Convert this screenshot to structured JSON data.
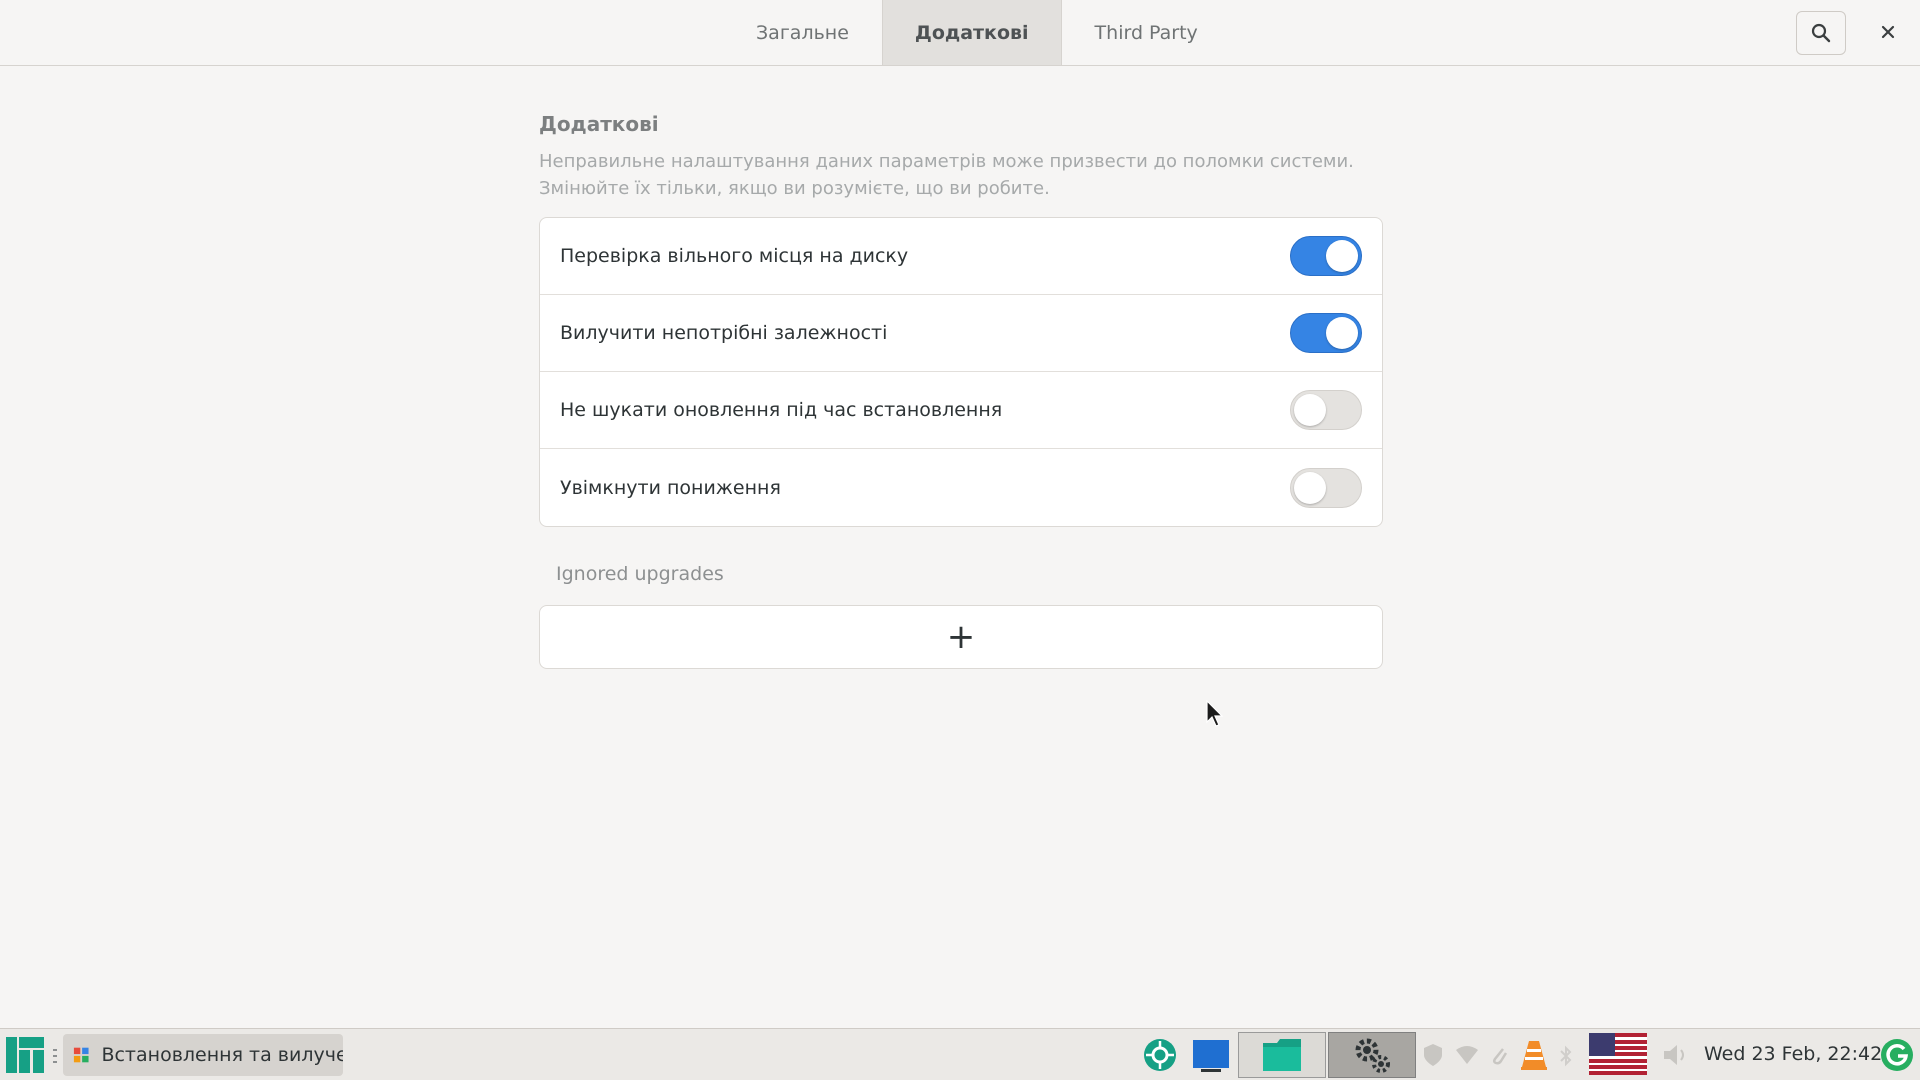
{
  "header": {
    "tabs": [
      {
        "label": "Загальне",
        "active": false
      },
      {
        "label": "Додаткові",
        "active": true
      },
      {
        "label": "Third Party",
        "active": false
      }
    ],
    "search_icon": "search-icon",
    "close_icon": "close-icon"
  },
  "section": {
    "title": "Додаткові",
    "description_line1": "Неправильне налаштування даних параметрів може призвести до поломки системи.",
    "description_line2": "Змінюйте їх тільки, якщо ви розумієте, що ви робите."
  },
  "settings": [
    {
      "label": "Перевірка вільного місця на диску",
      "enabled": true
    },
    {
      "label": "Вилучити непотрібні залежності",
      "enabled": true
    },
    {
      "label": "Не шукати оновлення під час встановлення",
      "enabled": false
    },
    {
      "label": "Увімкнути пониження",
      "enabled": false
    }
  ],
  "ignored_upgrades": {
    "label": "Ignored upgrades",
    "add_symbol": "+"
  },
  "taskbar": {
    "task_label": "Встановлення та вилуче...",
    "clock": "Wed 23 Feb, 22:42"
  },
  "colors": {
    "accent": "#3584e4",
    "manjaro_green": "#16a085"
  }
}
